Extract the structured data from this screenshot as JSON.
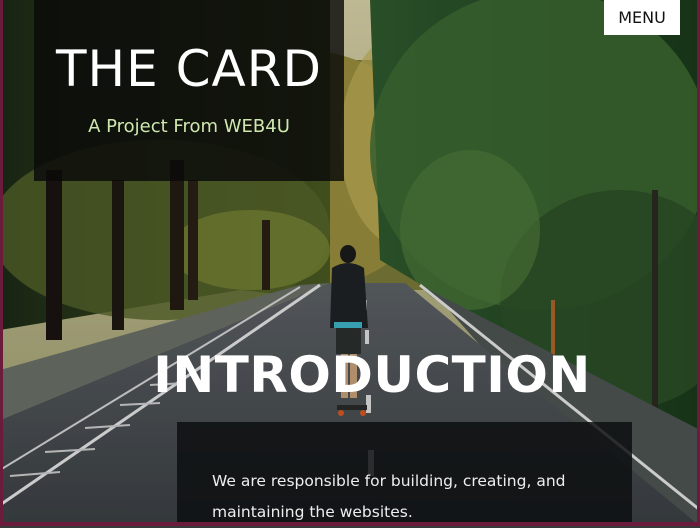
{
  "header": {
    "title": "THE CARD",
    "subtitle": "A Project From WEB4U"
  },
  "nav": {
    "menu_label": "MENU"
  },
  "intro": {
    "heading": "INTRODUCTION",
    "body": "We are responsible for building, creating, and maintaining the websites."
  },
  "background": {
    "image": "forest-road-skateboarder"
  },
  "colors": {
    "panel": "#0a0a0a",
    "subtitle": "#cfe8b0",
    "frame": "#6b1b3b"
  }
}
